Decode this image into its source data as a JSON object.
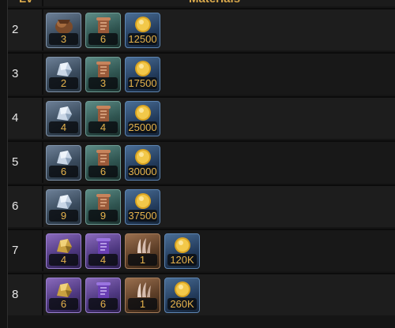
{
  "header": {
    "lv_label": "Lv",
    "materials_label": "Materials"
  },
  "rows": [
    {
      "level": "2",
      "items": [
        {
          "name": "Ore Pouch",
          "icon": "ore-pouch-icon",
          "qty": "3"
        },
        {
          "name": "Leather Scroll",
          "icon": "leather-scroll-icon",
          "qty": "6"
        },
        {
          "name": "Gold",
          "icon": "gold-coin-icon",
          "qty": "12500"
        }
      ]
    },
    {
      "level": "3",
      "items": [
        {
          "name": "Silver Ore",
          "icon": "silver-ore-icon",
          "qty": "2"
        },
        {
          "name": "Leather Scroll",
          "icon": "leather-scroll-icon",
          "qty": "3"
        },
        {
          "name": "Gold",
          "icon": "gold-coin-icon",
          "qty": "17500"
        }
      ]
    },
    {
      "level": "4",
      "items": [
        {
          "name": "Silver Ore",
          "icon": "silver-ore-icon",
          "qty": "4"
        },
        {
          "name": "Leather Scroll",
          "icon": "leather-scroll-icon",
          "qty": "4"
        },
        {
          "name": "Gold",
          "icon": "gold-coin-icon",
          "qty": "25000"
        }
      ]
    },
    {
      "level": "5",
      "items": [
        {
          "name": "Silver Ore",
          "icon": "silver-ore-icon",
          "qty": "6"
        },
        {
          "name": "Leather Scroll",
          "icon": "leather-scroll-icon",
          "qty": "6"
        },
        {
          "name": "Gold",
          "icon": "gold-coin-icon",
          "qty": "30000"
        }
      ]
    },
    {
      "level": "6",
      "items": [
        {
          "name": "Silver Ore",
          "icon": "silver-ore-icon",
          "qty": "9"
        },
        {
          "name": "Leather Scroll",
          "icon": "leather-scroll-icon",
          "qty": "9"
        },
        {
          "name": "Gold",
          "icon": "gold-coin-icon",
          "qty": "37500"
        }
      ]
    },
    {
      "level": "7",
      "items": [
        {
          "name": "Gold Ore",
          "icon": "gold-ore-icon",
          "qty": "4"
        },
        {
          "name": "Violet Scroll",
          "icon": "violet-scroll-icon",
          "qty": "4"
        },
        {
          "name": "Claw",
          "icon": "claw-icon",
          "qty": "1"
        },
        {
          "name": "Gold",
          "icon": "gold-coin-icon",
          "qty": "120K"
        }
      ]
    },
    {
      "level": "8",
      "items": [
        {
          "name": "Gold Ore",
          "icon": "gold-ore-icon",
          "qty": "6"
        },
        {
          "name": "Violet Scroll",
          "icon": "violet-scroll-icon",
          "qty": "6"
        },
        {
          "name": "Claw",
          "icon": "claw-icon",
          "qty": "1"
        },
        {
          "name": "Gold",
          "icon": "gold-coin-icon",
          "qty": "260K"
        }
      ]
    }
  ],
  "colors": {
    "accent_gold": "#d8a84c",
    "qty_text": "#e6b34c"
  }
}
